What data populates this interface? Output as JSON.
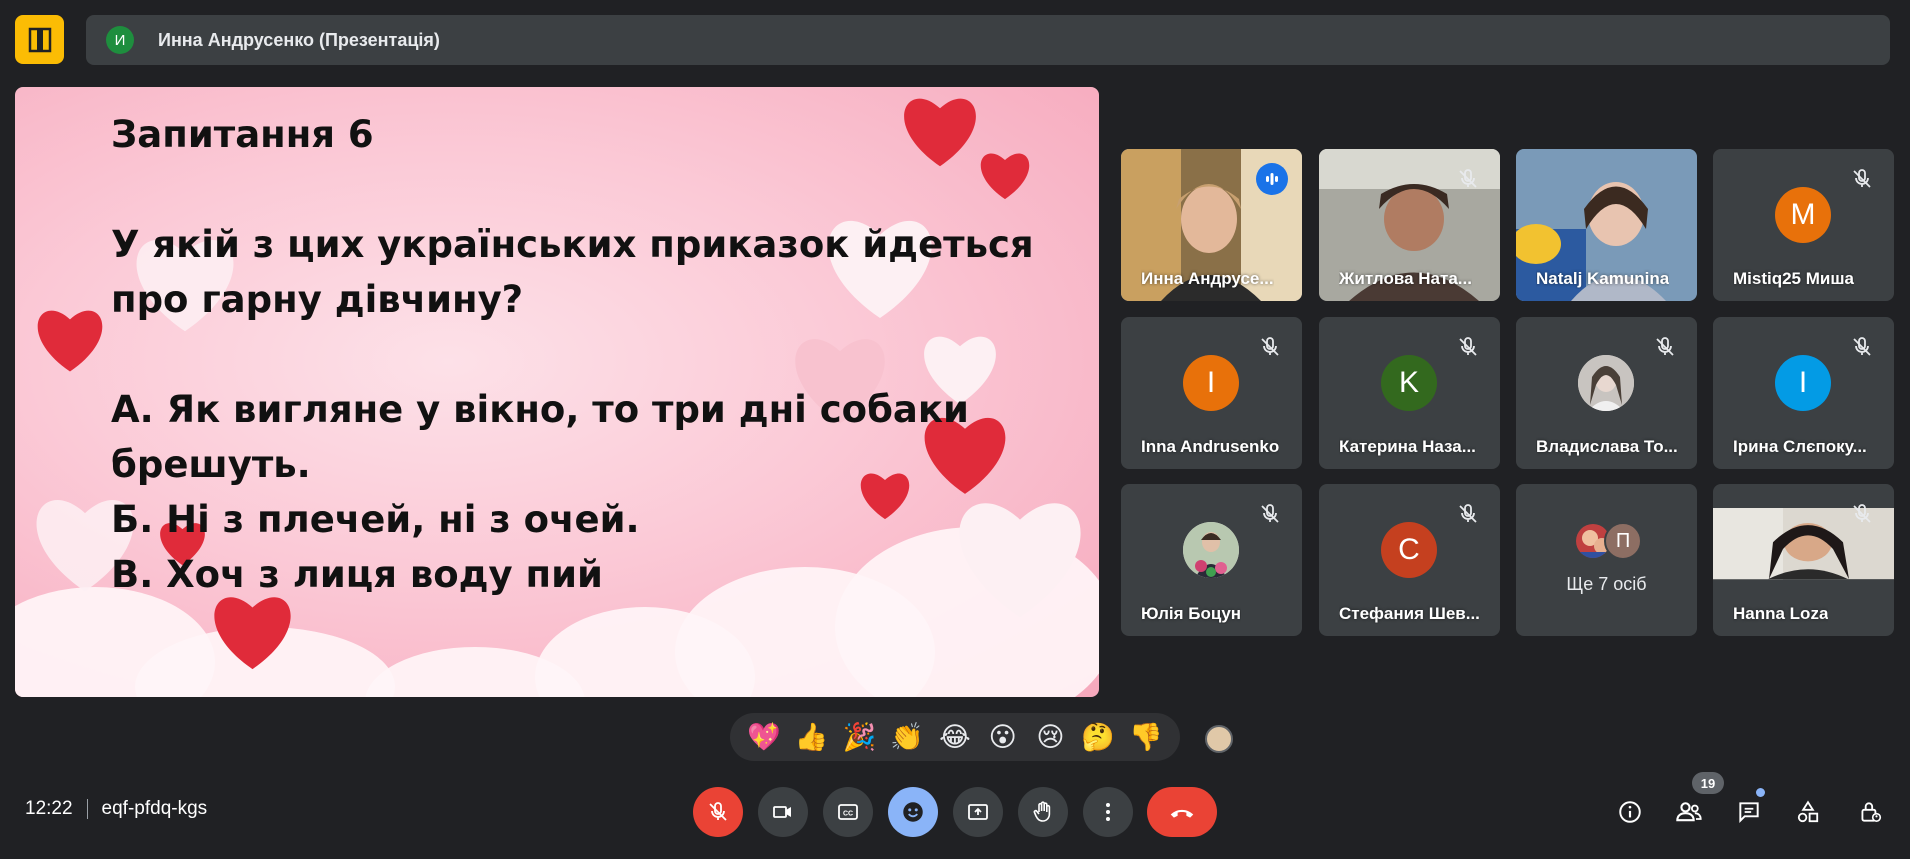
{
  "header": {
    "presenter_initial": "И",
    "presenter_label": "Инна Андрусенко (Презентація)"
  },
  "slide": {
    "lines": [
      "Запитання 6",
      "",
      "У якій з цих українських приказок йдеться",
      "про гарну дівчину?",
      "",
      "А. Як вигляне у вікно, то три дні собаки",
      "брешуть.",
      "Б. Ні з плечей, ні з очей.",
      "В. Хоч з лиця воду пий"
    ]
  },
  "participants": [
    {
      "name": "Инна Андрусенко",
      "display": "Инна Андрусе...",
      "initial": "",
      "color": "",
      "speaking": true,
      "video": true
    },
    {
      "name": "Житлова Наталія",
      "display": "Житлова Ната...",
      "initial": "",
      "color": "",
      "muted": true,
      "video": true
    },
    {
      "name": "Natalj Kamunina",
      "display": "Natalj Kamunina",
      "initial": "",
      "color": "",
      "video": true
    },
    {
      "name": "Mistiq25 Миша",
      "display": "Mistiq25 Миша",
      "initial": "M",
      "color": "#e8710a",
      "muted": true
    },
    {
      "name": "Inna Andrusenko",
      "display": "Inna Andrusenko",
      "initial": "I",
      "color": "#e8710a",
      "muted": true
    },
    {
      "name": "Катерина Назаренко",
      "display": "Катерина Наза...",
      "initial": "K",
      "color": "#33691e",
      "muted": true
    },
    {
      "name": "Владислава То",
      "display": "Владислава То...",
      "initial": "",
      "color": "#9e9e9e",
      "muted": true,
      "photo": true
    },
    {
      "name": "Ірина Слєпокурова",
      "display": "Ірина Слєпоку...",
      "initial": "I",
      "color": "#039be5",
      "muted": true
    },
    {
      "name": "Юлія Боцун",
      "display": "Юлія Боцун",
      "initial": "",
      "color": "#9e9e9e",
      "muted": true,
      "photo": true
    },
    {
      "name": "Стефания Шевченко",
      "display": "Стефания Шев...",
      "initial": "C",
      "color": "#c5401f",
      "muted": true
    },
    {
      "name": "Ще 7 осіб",
      "display": "Ще 7 осіб",
      "initial": "П",
      "color": "#8d6e63",
      "group": true
    },
    {
      "name": "Hanna Loza",
      "display": "Hanna Loza",
      "initial": "",
      "color": "",
      "muted": true,
      "video": true
    }
  ],
  "reactions": [
    "💖",
    "👍",
    "🎉",
    "👏",
    "😂",
    "😮",
    "😢",
    "🤔",
    "👎"
  ],
  "meeting": {
    "time": "12:22",
    "code": "eqf-pfdq-kgs"
  },
  "people_count": "19",
  "colors": {
    "bg": "#202124",
    "tile": "#3c4043",
    "accent": "#8ab4f8",
    "danger": "#ea4335",
    "logo": "#fbbc04"
  }
}
